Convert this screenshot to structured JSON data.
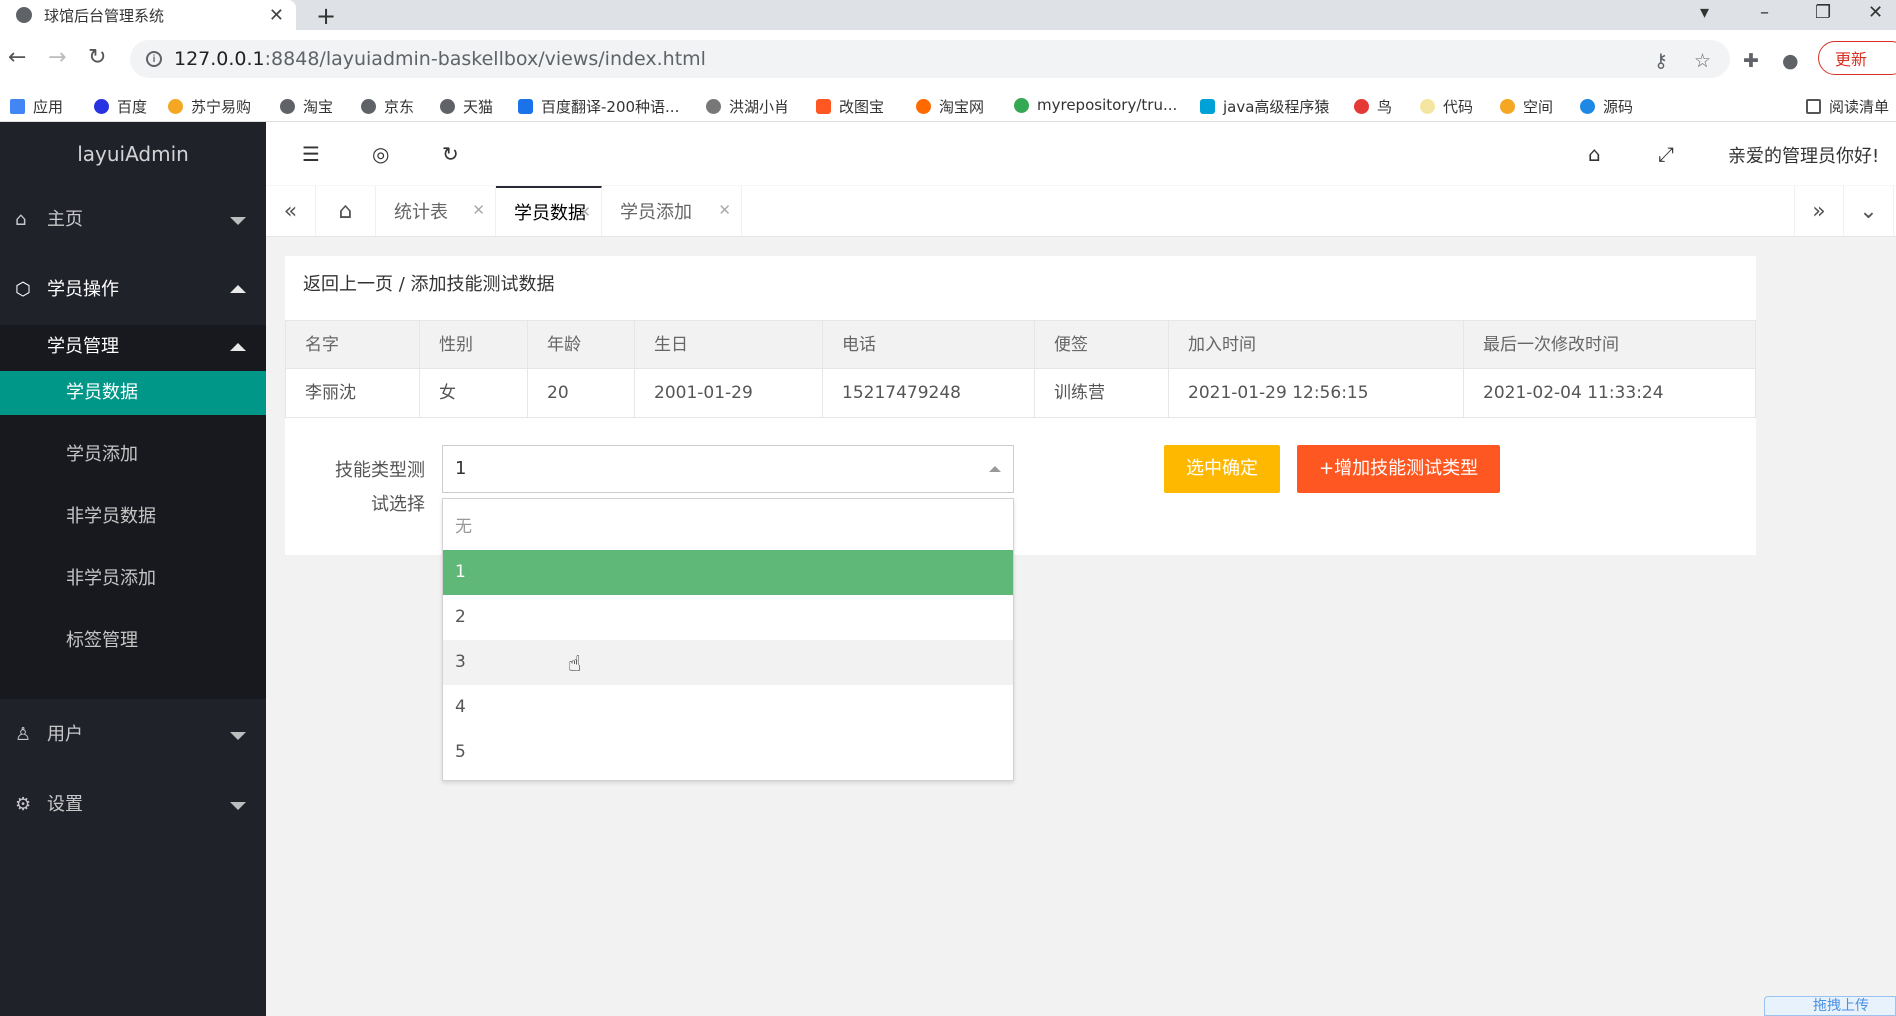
{
  "browser": {
    "tab_title": "球馆后台管理系统",
    "url_host": "127.0.0.1",
    "url_path": ":8848/layuiadmin-baskellbox/views/index.html",
    "update_label": "更新",
    "bookmarks": [
      "应用",
      "百度",
      "苏宁易购",
      "淘宝",
      "京东",
      "天猫",
      "百度翻译-200种语...",
      "洪湖小肖",
      "改图宝",
      "淘宝网",
      "myrepository/tru...",
      "java高级程序猿",
      "鸟",
      "代码",
      "空间",
      "源码",
      "阅读清单"
    ]
  },
  "sidebar": {
    "logo": "layuiAdmin",
    "items": [
      {
        "label": "主页",
        "icon": "home-icon"
      },
      {
        "label": "学员操作",
        "icon": "cube-icon"
      },
      {
        "label": "用户",
        "icon": "user-icon"
      },
      {
        "label": "设置",
        "icon": "gear-icon"
      }
    ],
    "group": "学员管理",
    "subitems": [
      "学员数据",
      "学员添加",
      "非学员数据",
      "非学员添加",
      "标签管理"
    ]
  },
  "header": {
    "greeting": "亲爱的管理员你好!"
  },
  "pagetabs": {
    "tabs": [
      "统计表",
      "学员数据",
      "学员添加"
    ],
    "active": "学员数据"
  },
  "main": {
    "breadcrumb": "返回上一页 / 添加技能测试数据",
    "table": {
      "headers": [
        "名字",
        "性别",
        "年龄",
        "生日",
        "电话",
        "便签",
        "加入时间",
        "最后一次修改时间"
      ],
      "row": [
        "李丽沈",
        "女",
        "20",
        "2001-01-29",
        "15217479248",
        "训练营",
        "2021-01-29 12:56:15",
        "2021-02-04 11:33:24"
      ]
    },
    "form_label": "技能类型测试选择",
    "select_value": "1",
    "confirm_button": "选中确定",
    "add_button": "+增加技能测试类型",
    "options": [
      "无",
      "1",
      "2",
      "3",
      "4",
      "5"
    ],
    "selected_option": "1",
    "hover_option": "3"
  },
  "upload_badge": "拖拽上传",
  "colors": {
    "sidebar_bg": "#20222a",
    "active_green": "#009688",
    "selected_option": "#5fb878",
    "warm_button": "#ffb800",
    "danger_button": "#ff5722"
  }
}
